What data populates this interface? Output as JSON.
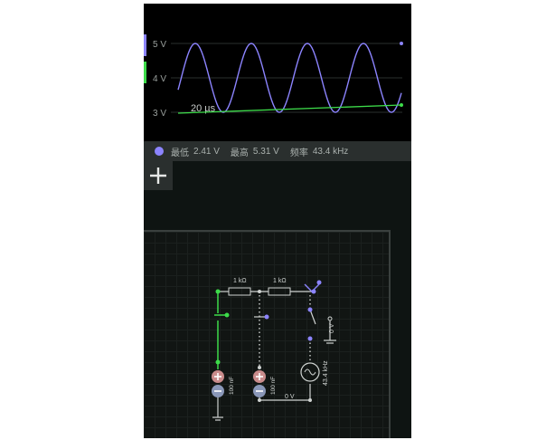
{
  "scope": {
    "labels": [
      "5 V",
      "4 V",
      "3 V"
    ],
    "time_label": "20 µs",
    "trace_colors": {
      "voltage": "#8c84ff",
      "reference": "#3ddc4a"
    }
  },
  "readout": {
    "min_label": "最低",
    "min_value": "2.41 V",
    "max_label": "最高",
    "max_value": "5.31 V",
    "freq_label": "频率",
    "freq_value": "43.4 kHz"
  },
  "circuit": {
    "r1": "1 kΩ",
    "r2": "1 kΩ",
    "c1": "100 nF",
    "c2": "100 nF",
    "source_freq": "43.4 kHz",
    "probe_v": "0 V",
    "ground_v": "0 V"
  }
}
